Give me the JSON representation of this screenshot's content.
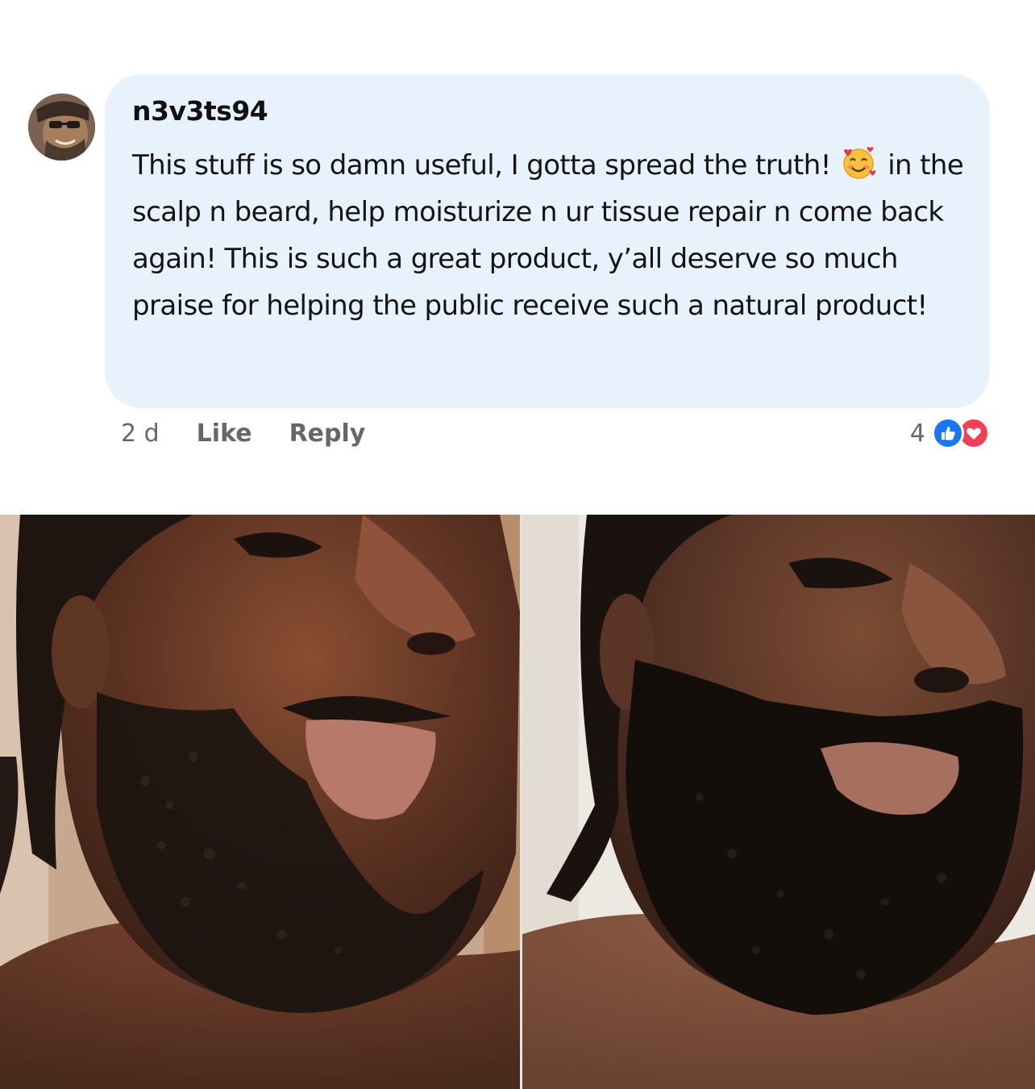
{
  "comment": {
    "username": "n3v3ts94",
    "text_part1": "This stuff is so damn useful, I gotta spread the truth!",
    "emoji": "smiling-face-with-hearts-emoji",
    "text_part2": "in the scalp n beard, help moisturize n ur tissue repair n come back again! This is such a great product, y’all deserve so much praise for helping the public receive such a natural product!",
    "bubble_color": "#e8f2fd"
  },
  "actions": {
    "time": "2 d",
    "like_label": "Like",
    "reply_label": "Reply"
  },
  "reactions": {
    "count": "4",
    "types": [
      "like-icon",
      "love-icon"
    ],
    "like_color": "#1877f2",
    "love_color": "#f33e58"
  },
  "photos": [
    {
      "name": "before-photo",
      "description_icon": "beard-before-photo"
    },
    {
      "name": "after-photo",
      "description_icon": "beard-after-photo"
    }
  ]
}
